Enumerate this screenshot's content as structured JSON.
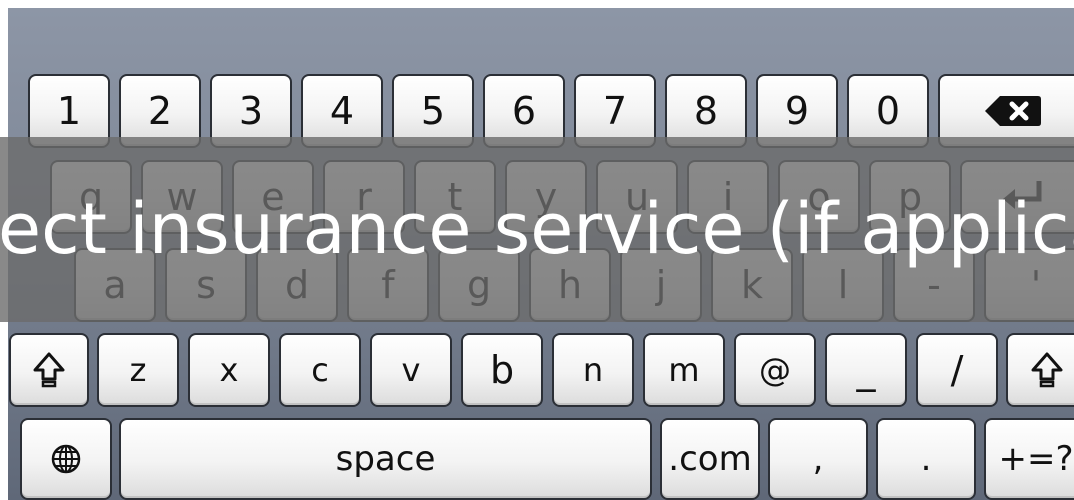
{
  "keyboard": {
    "number_row": [
      "1",
      "2",
      "3",
      "4",
      "5",
      "6",
      "7",
      "8",
      "9",
      "0"
    ],
    "qwerty_row": [
      "q",
      "w",
      "e",
      "r",
      "t",
      "y",
      "u",
      "i",
      "o",
      "p"
    ],
    "home_row": [
      "a",
      "s",
      "d",
      "f",
      "g",
      "h",
      "j",
      "k",
      "l",
      "-",
      "'"
    ],
    "bottom_row": [
      "z",
      "x",
      "c",
      "v",
      "b",
      "n",
      "m",
      "@",
      "_",
      "/"
    ],
    "space_label": "space",
    "com_label": ".com",
    "comma_label": ",",
    "period_label": ".",
    "symbols_label": "+=?",
    "icons": {
      "backspace": "backspace-icon",
      "enter": "enter-icon",
      "shift": "shift-icon",
      "globe": "globe-icon"
    }
  },
  "overlay": {
    "caption": "ect insurance service (if applicab"
  },
  "colors": {
    "keyboard_bg": "#7f8898",
    "key_face": "#f5f5f5",
    "key_border": "#2b2f36",
    "overlay": "#6c6c6c"
  }
}
